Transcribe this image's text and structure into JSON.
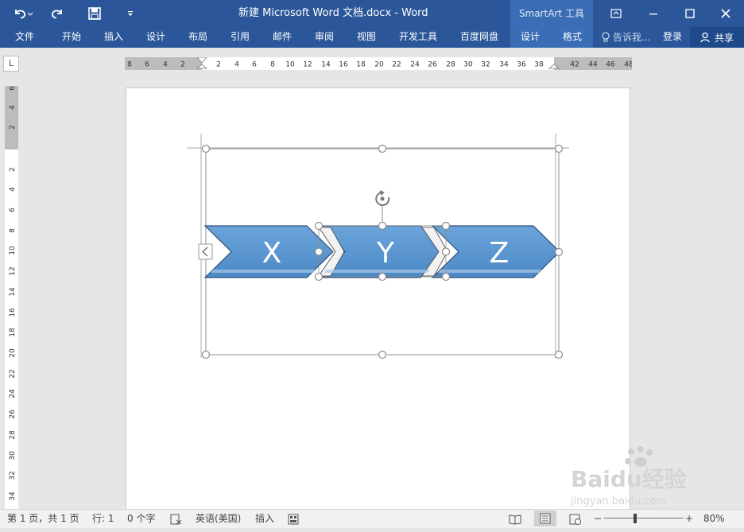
{
  "window": {
    "title": "新建 Microsoft Word 文档.docx - Word",
    "context_tab": "SmartArt 工具"
  },
  "ribbon": {
    "tabs": [
      "文件",
      "开始",
      "插入",
      "设计",
      "布局",
      "引用",
      "邮件",
      "审阅",
      "视图",
      "开发工具",
      "百度网盘",
      "设计",
      "格式"
    ],
    "tell_me": "告诉我...",
    "login": "登录",
    "share": "共享"
  },
  "ruler": {
    "corner": "L",
    "h_ticks": [
      "8",
      "6",
      "4",
      "2",
      "2",
      "4",
      "6",
      "8",
      "10",
      "12",
      "14",
      "16",
      "18",
      "20",
      "22",
      "24",
      "26",
      "28",
      "30",
      "32",
      "34",
      "36",
      "38",
      "42",
      "44",
      "46",
      "48"
    ],
    "v_ticks": [
      "6",
      "4",
      "2",
      "2",
      "4",
      "6",
      "8",
      "10",
      "12",
      "14",
      "16",
      "18",
      "20",
      "22",
      "24",
      "26",
      "28",
      "30",
      "32",
      "34"
    ]
  },
  "smartart": {
    "shapes": [
      "X",
      "Y",
      "Z"
    ],
    "fill_color": "#5b9bd5",
    "outline_color": "#2f4f77"
  },
  "status": {
    "page": "第 1 页，共 1 页",
    "line": "行: 1",
    "words": "0 个字",
    "language": "英语(美国)",
    "mode": "插入",
    "zoom": "80%"
  },
  "watermark": {
    "brand": "Baidu经验",
    "url": "jingyan.baidu.com"
  }
}
